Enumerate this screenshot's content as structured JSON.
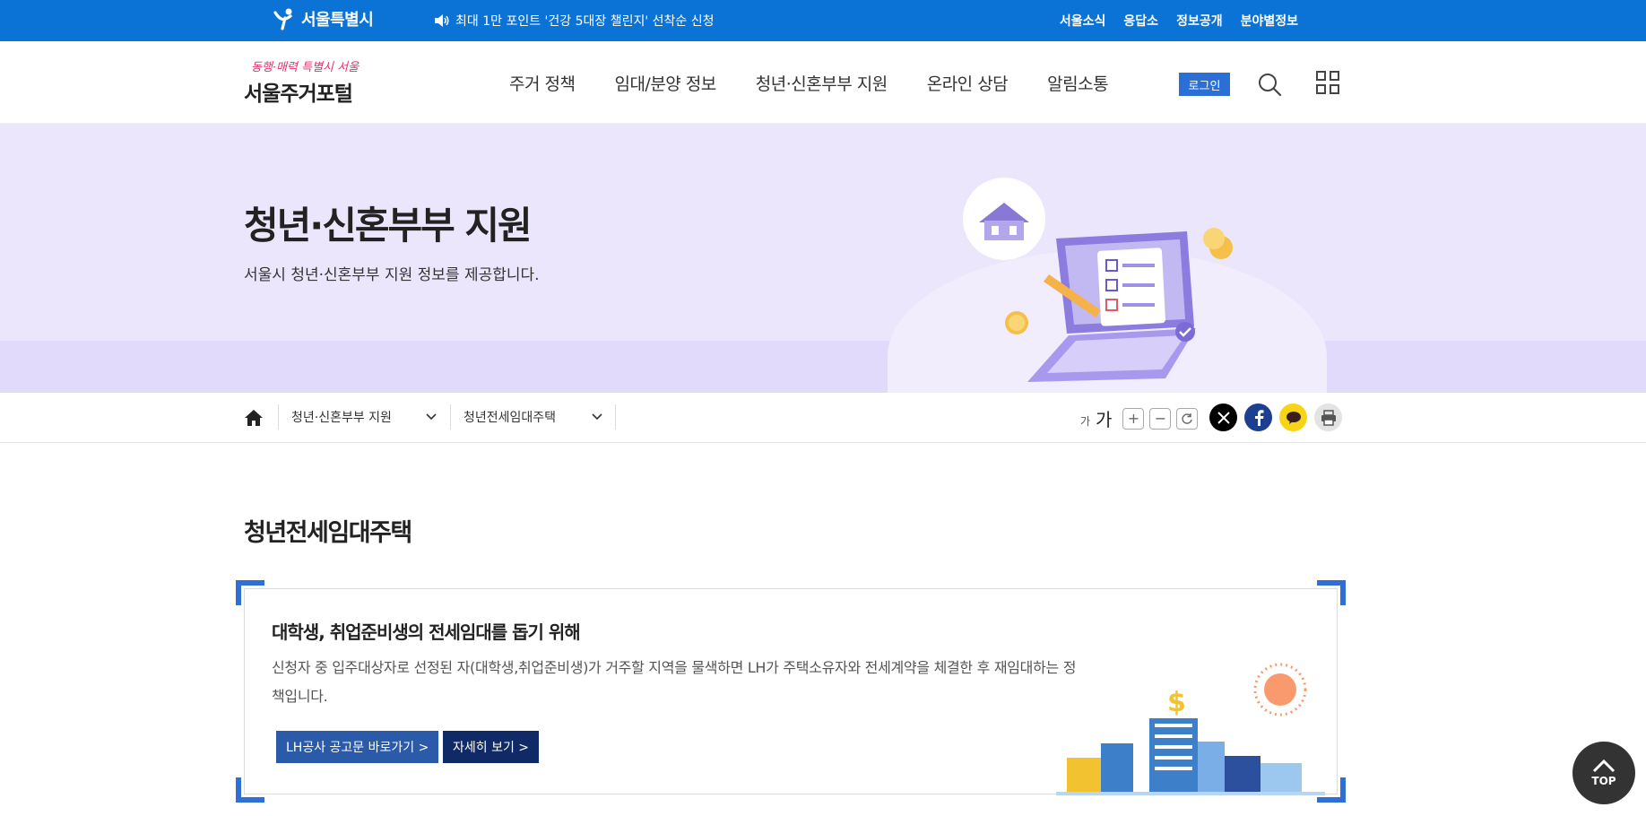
{
  "topbar": {
    "city_name": "서울특별시",
    "notice": "최대 1만 포인트 '건강 5대장 챌린지' 선착순 신청",
    "util_links": [
      "서울소식",
      "응답소",
      "정보공개",
      "분야별정보"
    ]
  },
  "header": {
    "slogan": "동행·매력 특별시 서울",
    "site_name": "서울주거포털",
    "nav": [
      "주거 정책",
      "임대/분양 정보",
      "청년·신혼부부 지원",
      "온라인 상담",
      "알림소통"
    ],
    "login_label": "로그인"
  },
  "visual": {
    "title": "청년·신혼부부 지원",
    "subtitle": "서울시 청년·신혼부부 지원 정보를 제공합니다."
  },
  "location": {
    "depth1": "청년·신혼부부 지원",
    "depth2": "청년전세임대주택",
    "font_small": "가",
    "font_large": "가"
  },
  "content": {
    "page_title": "청년전세임대주택",
    "card_title": "대학생, 취업준비생의 전세임대를 돕기 위해",
    "card_desc": "신청자 중 입주대상자로 선정된 자(대학생,취업준비생)가 거주할 지역을 물색하면 LH가 주택소유자와 전세계약을 체결한 후 재임대하는 정책입니다.",
    "btn_lh": "LH공사 공고문 바로가기 >",
    "btn_detail": "자세히 보기 >",
    "city_sign": "$"
  },
  "top_button": "TOP",
  "colors": {
    "topbar_bg": "#0b73d6",
    "visual_bg": "#ebe6fb",
    "accent_blue": "#2f6fd6",
    "btn_lh": "#2a5aa8",
    "btn_detail": "#0f2a66"
  }
}
